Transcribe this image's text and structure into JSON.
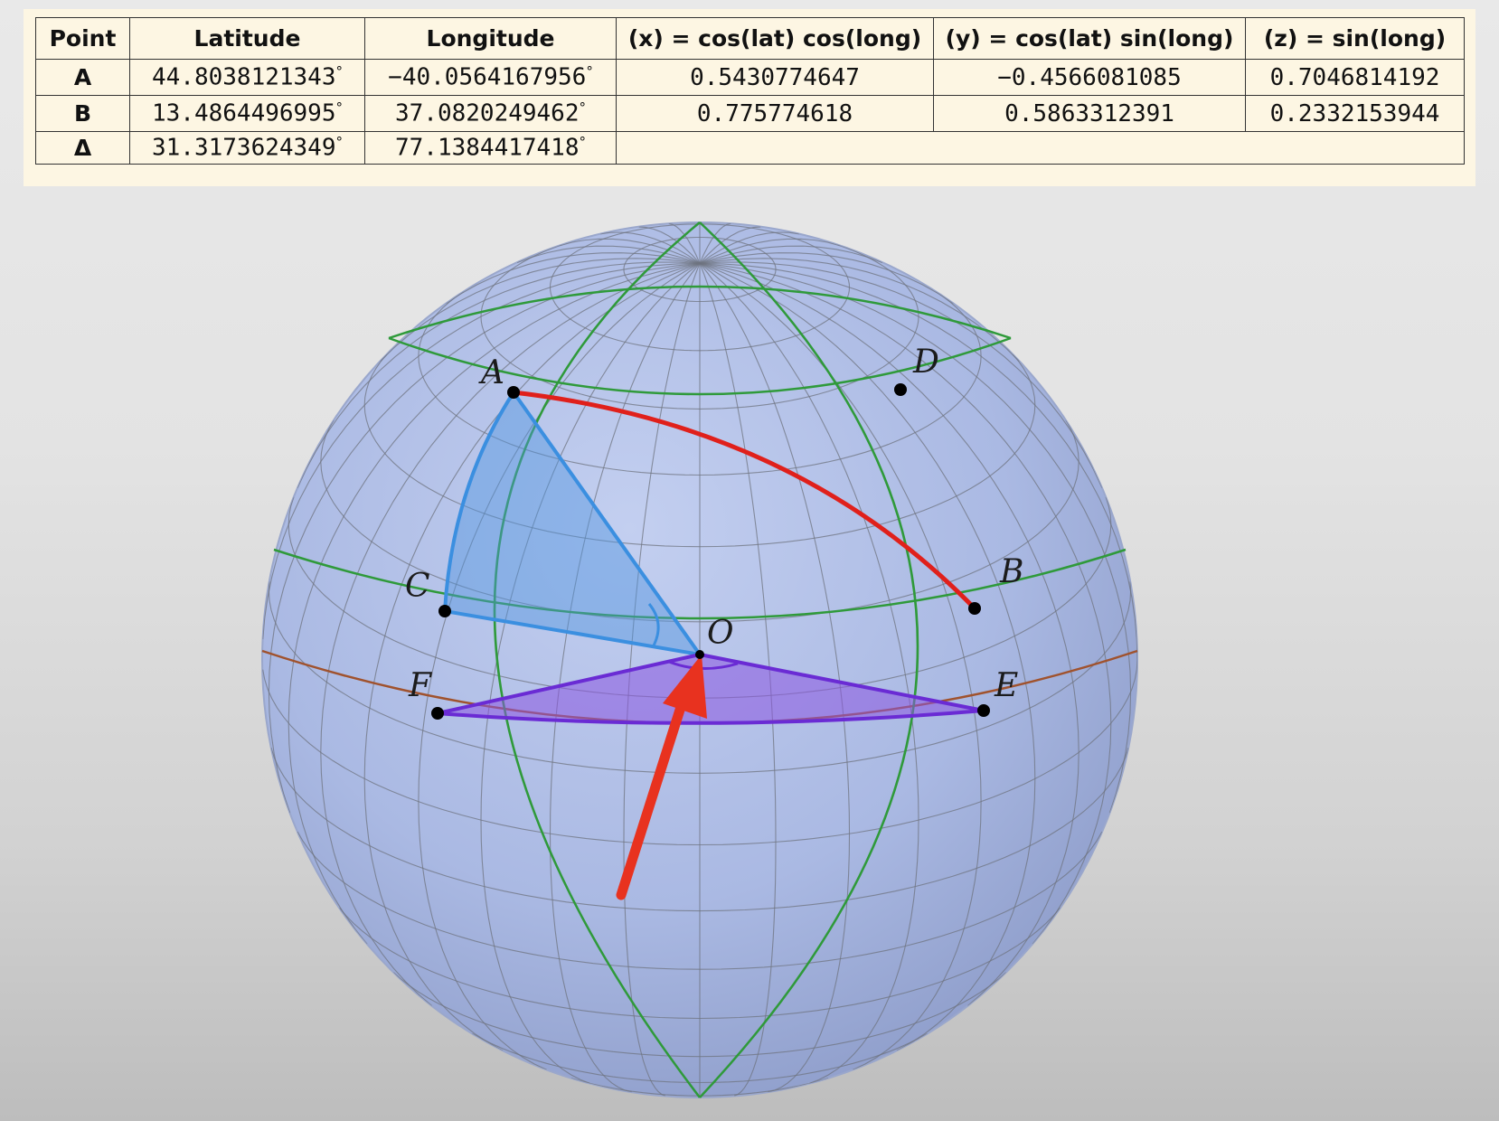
{
  "table": {
    "headers": [
      "Point",
      "Latitude",
      "Longitude",
      "(x) = cos(lat) cos(long)",
      "(y) = cos(lat) sin(long)",
      "(z) = sin(long)"
    ],
    "rows": [
      [
        "A",
        "44.8038121343",
        "−40.0564167956",
        "0.5430774647",
        "−0.4566081085",
        "0.7046814192"
      ],
      [
        "B",
        "13.4864496995",
        "37.0820249462",
        "0.775774618",
        "0.5863312391",
        "0.2332153944"
      ],
      [
        "Δ",
        "31.3173624349",
        "77.1384417418",
        "",
        "",
        ""
      ]
    ],
    "degree_symbol": "°"
  },
  "diagram": {
    "point_labels": {
      "A": "A",
      "B": "B",
      "C": "C",
      "D": "D",
      "E": "E",
      "F": "F",
      "O": "O"
    },
    "colors": {
      "sphere_fill": "#aab9e3",
      "grid": "#6f7480",
      "meridian_green": "#2f9a3a",
      "equator": "#a0522d",
      "great_circle_arc": "#e0201b",
      "sector_ACO": "#3b8fe0",
      "triangle_FOE": "#6a2bd4",
      "arrow": "#e8321f"
    }
  }
}
